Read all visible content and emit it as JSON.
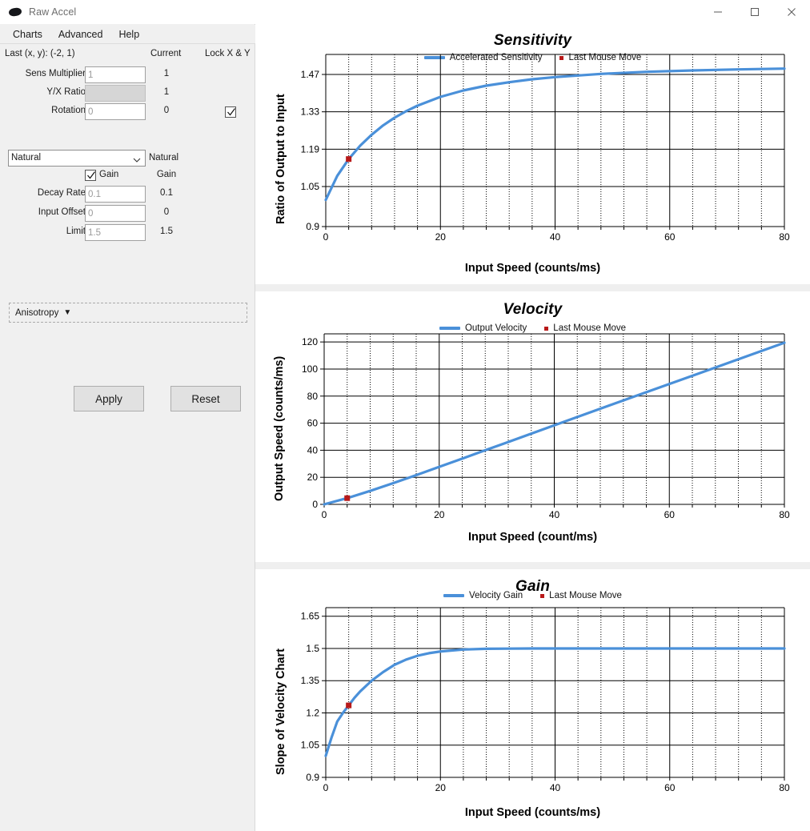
{
  "window": {
    "title": "Raw Accel",
    "icon": "mouse-icon",
    "controls": {
      "minimize": "minimize-icon",
      "maximize": "maximize-icon",
      "close": "close-icon"
    }
  },
  "menu": {
    "items": [
      {
        "label": "Charts"
      },
      {
        "label": "Advanced"
      },
      {
        "label": "Help"
      }
    ]
  },
  "panel": {
    "last_xy": "Last (x, y): (-2, 1)",
    "header_current": "Current",
    "header_lock": "Lock X & Y",
    "lock_checked": true,
    "fields": [
      {
        "label": "Sens Multiplier",
        "value": "1",
        "current": "1",
        "disabled": false
      },
      {
        "label": "Y/X Ratio",
        "value": "",
        "current": "1",
        "disabled": true
      },
      {
        "label": "Rotation",
        "value": "0",
        "current": "0",
        "disabled": false
      }
    ],
    "mode": {
      "selected": "Natural",
      "current": "Natural",
      "caret": "chevron-down-icon"
    },
    "gain": {
      "label": "Gain",
      "current": "Gain",
      "checked": true
    },
    "fields2": [
      {
        "label": "Decay Rate",
        "value": "0.1",
        "current": "0.1",
        "disabled": false
      },
      {
        "label": "Input Offset",
        "value": "0",
        "current": "0",
        "disabled": false
      },
      {
        "label": "Limit",
        "value": "1.5",
        "current": "1.5",
        "disabled": false
      }
    ],
    "anisotropy": {
      "label": "Anisotropy",
      "caret": "triangle-down-icon"
    },
    "apply_label": "Apply",
    "reset_label": "Reset"
  },
  "colors": {
    "series": "#4a90d9",
    "marker": "#b81919",
    "panel_bg": "#f0f0f0",
    "grid": "#000000"
  },
  "chart_data": [
    {
      "type": "line",
      "id": "sensitivity",
      "title": "Sensitivity",
      "xlabel": "Input Speed (counts/ms)",
      "ylabel": "Ratio of Output to Input",
      "xlim": [
        0,
        80
      ],
      "ylim": [
        0.9,
        1.545
      ],
      "xticks": [
        0,
        20,
        40,
        60,
        80
      ],
      "yticks": [
        0.9,
        1.05,
        1.19,
        1.33,
        1.47
      ],
      "ytick_labels": [
        "0.9",
        "1.05",
        "1.19",
        "1.33",
        "1.47"
      ],
      "minor_x_step": 4,
      "grid": true,
      "legend": [
        {
          "name": "Accelerated Sensitivity",
          "marker": "line",
          "color": "#4a90d9"
        },
        {
          "name": "Last Mouse Move",
          "marker": "square",
          "color": "#b81919"
        }
      ],
      "x": [
        0,
        2,
        4,
        6,
        8,
        10,
        12,
        14,
        16,
        20,
        24,
        28,
        32,
        36,
        40,
        48,
        56,
        64,
        72,
        80
      ],
      "y": [
        1.0,
        1.09,
        1.153,
        1.203,
        1.244,
        1.279,
        1.308,
        1.332,
        1.353,
        1.386,
        1.41,
        1.428,
        1.441,
        1.452,
        1.46,
        1.472,
        1.48,
        1.485,
        1.489,
        1.492
      ],
      "annotations": [
        {
          "name": "Last Mouse Move",
          "x": 4,
          "y": 1.153
        }
      ]
    },
    {
      "type": "line",
      "id": "velocity",
      "title": "Velocity",
      "xlabel": "Input Speed (count/ms)",
      "ylabel": "Output Speed (counts/ms)",
      "xlim": [
        0,
        80
      ],
      "ylim": [
        0,
        126
      ],
      "xticks": [
        0,
        20,
        40,
        60,
        80
      ],
      "yticks": [
        0,
        20,
        40,
        60,
        80,
        100,
        120
      ],
      "ytick_labels": [
        "0",
        "20",
        "40",
        "60",
        "80",
        "100",
        "120"
      ],
      "minor_x_step": 4,
      "grid": true,
      "legend": [
        {
          "name": "Output Velocity",
          "marker": "line",
          "color": "#4a90d9"
        },
        {
          "name": "Last Mouse Move",
          "marker": "square",
          "color": "#b81919"
        }
      ],
      "x": [
        0,
        4,
        8,
        12,
        16,
        20,
        24,
        28,
        32,
        40,
        48,
        56,
        64,
        72,
        80
      ],
      "y": [
        0,
        4.6,
        9.95,
        15.7,
        21.6,
        27.7,
        33.8,
        40.0,
        46.1,
        58.4,
        70.7,
        82.9,
        95.0,
        107.2,
        119.4
      ],
      "annotations": [
        {
          "name": "Last Mouse Move",
          "x": 4,
          "y": 4.6
        }
      ]
    },
    {
      "type": "line",
      "id": "gain",
      "title": "Gain",
      "xlabel": "Input Speed (counts/ms)",
      "ylabel": "Slope of Velocity Chart",
      "xlim": [
        0,
        80
      ],
      "ylim": [
        0.9,
        1.69
      ],
      "xticks": [
        0,
        20,
        40,
        60,
        80
      ],
      "yticks": [
        0.9,
        1.05,
        1.2,
        1.35,
        1.5,
        1.65
      ],
      "ytick_labels": [
        "0.9",
        "1.05",
        "1.2",
        "1.35",
        "1.5",
        "1.65"
      ],
      "minor_x_step": 4,
      "grid": true,
      "legend": [
        {
          "name": "Velocity Gain",
          "marker": "line",
          "color": "#4a90d9"
        },
        {
          "name": "Last Mouse Move",
          "marker": "square",
          "color": "#b81919"
        }
      ],
      "x": [
        0,
        1,
        2,
        3,
        4,
        5,
        6,
        8,
        10,
        12,
        14,
        16,
        18,
        20,
        24,
        28,
        36,
        50,
        65,
        80
      ],
      "y": [
        1.0,
        1.085,
        1.16,
        1.2,
        1.235,
        1.27,
        1.3,
        1.35,
        1.39,
        1.424,
        1.448,
        1.466,
        1.478,
        1.486,
        1.495,
        1.4985,
        1.4999,
        1.5,
        1.5,
        1.5
      ],
      "annotations": [
        {
          "name": "Last Mouse Move",
          "x": 4,
          "y": 1.235
        }
      ]
    }
  ]
}
